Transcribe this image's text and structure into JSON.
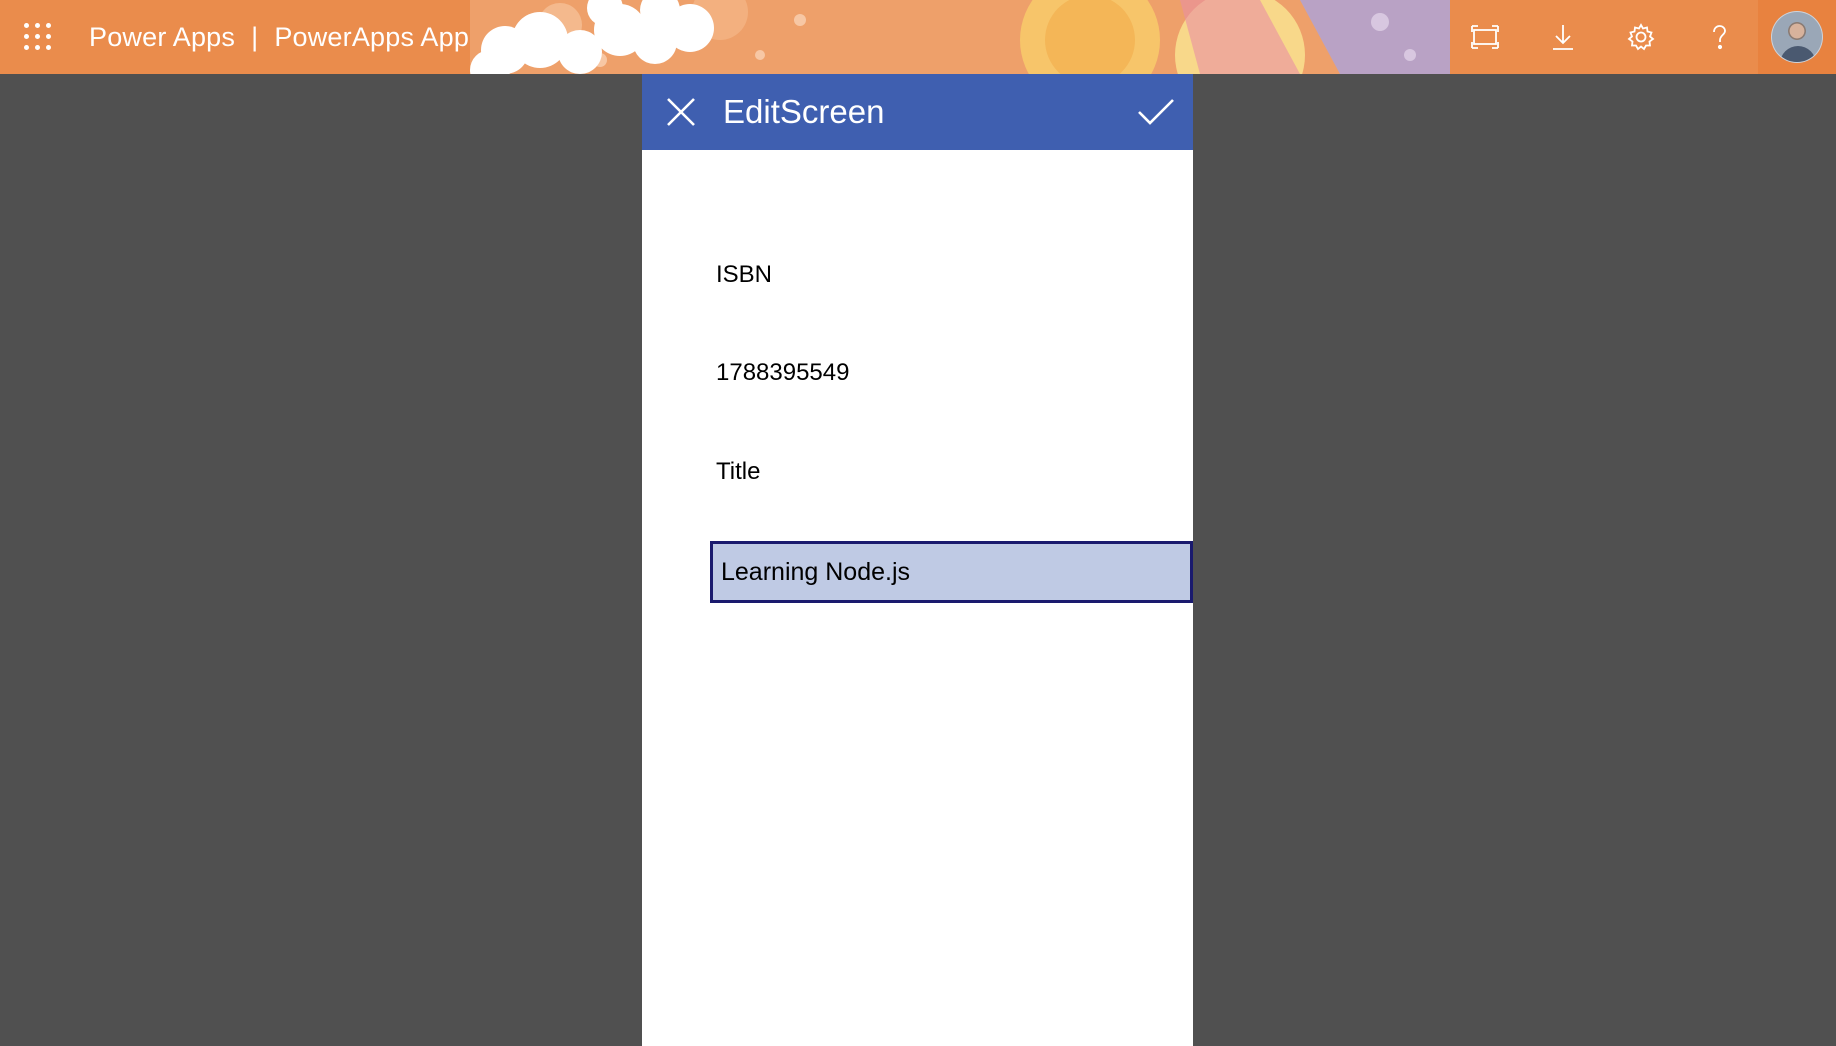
{
  "suitebar": {
    "product": "Power Apps",
    "separator": "|",
    "app_name": "PowerApps App",
    "icons": [
      "app-launcher-icon",
      "fullscreen-icon",
      "download-icon",
      "settings-icon",
      "help-icon",
      "profile-avatar"
    ],
    "accent": "#ea8c4c"
  },
  "screen": {
    "title": "EditScreen",
    "header_color": "#3f5fb0",
    "close_icon": "close-icon",
    "submit_icon": "checkmark-icon"
  },
  "form": {
    "isbn_label": "ISBN",
    "isbn_value": "1788395549",
    "title_label": "Title",
    "title_input_value": "Learning Node.js"
  }
}
